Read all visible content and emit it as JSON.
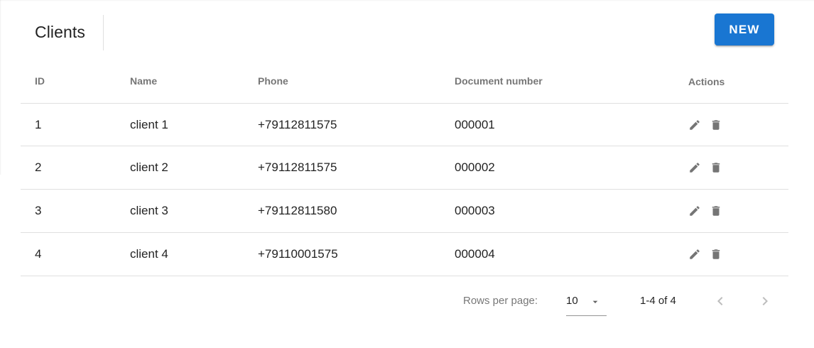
{
  "header": {
    "title": "Clients",
    "new_button_label": "NEW"
  },
  "table": {
    "columns": {
      "id": "ID",
      "name": "Name",
      "phone": "Phone",
      "document_number": "Document number",
      "actions": "Actions"
    },
    "rows": [
      {
        "id": "1",
        "name": "client 1",
        "phone": "+79112811575",
        "document_number": "000001",
        "actions": [
          "edit-icon",
          "delete-icon"
        ]
      },
      {
        "id": "2",
        "name": "client 2",
        "phone": "+79112811575",
        "document_number": "000002",
        "actions": [
          "edit-icon",
          "delete-icon"
        ]
      },
      {
        "id": "3",
        "name": "client 3",
        "phone": "+79112811580",
        "document_number": "000003",
        "actions": [
          "edit-icon",
          "delete-icon"
        ]
      },
      {
        "id": "4",
        "name": "client 4",
        "phone": "+79110001575",
        "document_number": "000004",
        "actions": [
          "edit-icon",
          "delete-icon"
        ]
      }
    ]
  },
  "pagination": {
    "rows_per_page_label": "Rows per page:",
    "rows_per_page_value": "10",
    "range_text": "1-4 of 4",
    "prev_icon": "chevron-left-icon",
    "next_icon": "chevron-right-icon"
  },
  "colors": {
    "primary": "#1976d2",
    "icon": "#757575",
    "disabled_icon": "#bdbdbd",
    "divider": "rgba(0,0,0,0.12)"
  }
}
